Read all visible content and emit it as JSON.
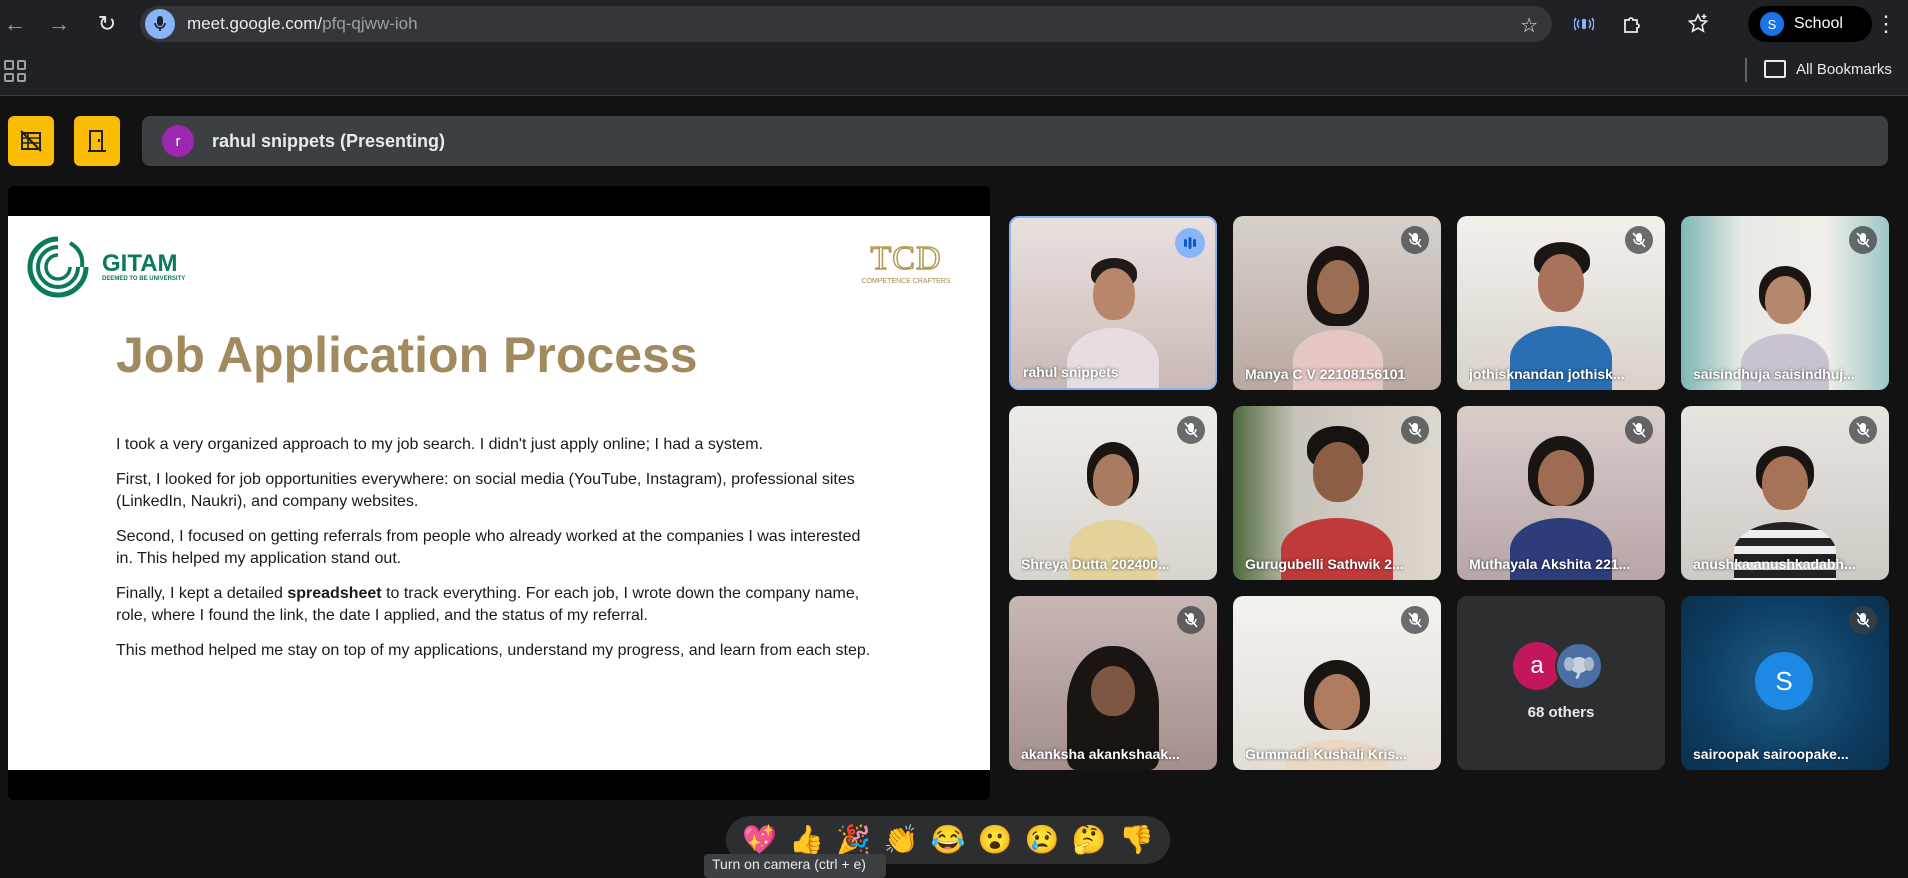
{
  "browser": {
    "url_host": "meet.google.com/",
    "url_path": "pfq-qjww-ioh",
    "profile_initial": "S",
    "profile_label": "School",
    "bookmarks_label": "All Bookmarks"
  },
  "meet": {
    "presenter_initial": "r",
    "presenter_label": "rahul snippets (Presenting)"
  },
  "slide": {
    "logo_text": "GITAM",
    "logo_subtext": "DEEMED TO BE UNIVERSITY",
    "tcd_text": "TCD",
    "tcd_subtext": "COMPETENCE CRAFTERS",
    "title": "Job Application Process",
    "p1": "I took a very organized approach to my job search. I didn't just apply online; I had a system.",
    "p2": "First, I looked for job opportunities everywhere: on social media (YouTube, Instagram), professional sites (LinkedIn, Naukri), and company websites.",
    "p3": "Second, I focused on getting referrals from people who already worked at the companies I was interested in. This helped my application stand out.",
    "p4_pre": "Finally, I kept a detailed ",
    "p4_bold": "spreadsheet",
    "p4_post": " to track everything. For each job, I wrote down the company name, role, where I found the link, the date I applied, and the status of my referral.",
    "p5": "This method helped me stay on top of my applications, understand my progress, and learn from each step."
  },
  "participants": [
    {
      "name": "rahul snippets"
    },
    {
      "name": "Manya C V 22108156101"
    },
    {
      "name": "jothisknandan jothisk..."
    },
    {
      "name": "saisindhuja saisindhuj..."
    },
    {
      "name": "Shreya Dutta 202400..."
    },
    {
      "name": "Gurugubelli Sathwik 2..."
    },
    {
      "name": "Muthayala Akshita 221..."
    },
    {
      "name": "anushka anushkadabh..."
    },
    {
      "name": "akanksha akankshaak..."
    },
    {
      "name": "Gummadi Kushali Kris..."
    },
    {
      "name": "sairoopak sairoopake..."
    }
  ],
  "others": {
    "avatar_initial": "a",
    "label": "68 others"
  },
  "sairoopak_initial": "S",
  "reactions": [
    "💖",
    "👍",
    "🎉",
    "👏",
    "😂",
    "😮",
    "😢",
    "🤔",
    "👎"
  ],
  "tooltip": "Turn on camera (ctrl + e)"
}
